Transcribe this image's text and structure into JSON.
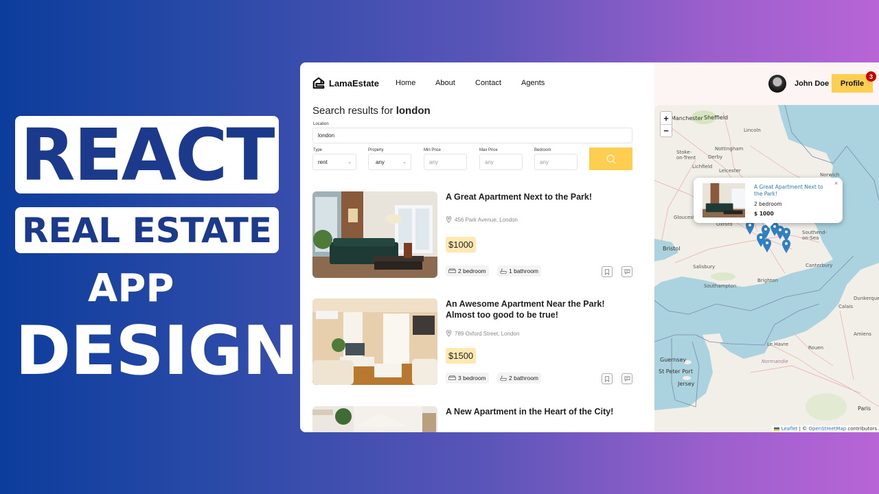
{
  "promo": {
    "line1": "REACT",
    "line2": "REAL ESTATE",
    "line3": "APP",
    "line4": "DESIGN"
  },
  "navbar": {
    "brand": "LamaEstate",
    "links": [
      "Home",
      "About",
      "Contact",
      "Agents"
    ],
    "user_name": "John Doe",
    "profile_label": "Profile",
    "notification_count": "3"
  },
  "search": {
    "title_prefix": "Search results for",
    "query": "london",
    "location_label": "Location",
    "location_value": "london",
    "type_label": "Type",
    "type_value": "rent",
    "property_label": "Property",
    "property_value": "any",
    "min_price_label": "Min Price",
    "min_price_placeholder": "any",
    "max_price_label": "Max Price",
    "max_price_placeholder": "any",
    "bedroom_label": "Bedroom",
    "bedroom_placeholder": "any"
  },
  "listings": [
    {
      "title": "A Great Apartment Next to the Park!",
      "address": "456 Park Avenue, London",
      "price": "$1000",
      "bedrooms": "2 bedroom",
      "bathrooms": "1 bathroom"
    },
    {
      "title": "An Awesome Apartment Near the Park! Almost too good to be true!",
      "address": "789 Oxford Street, London",
      "price": "$1500",
      "bedrooms": "3 bedroom",
      "bathrooms": "2 bathroom"
    },
    {
      "title": "A New Apartment in the Heart of the City!"
    }
  ],
  "map": {
    "zoom_in": "+",
    "zoom_out": "−",
    "popup": {
      "title": "A Great Apartment Next to the Park!",
      "bedrooms": "2 bedroom",
      "price": "$ 1000",
      "close": "×"
    },
    "attribution_leaflet": "Leaflet",
    "attribution_sep": " | © ",
    "attribution_osm": "OpenStreetMap",
    "attribution_suffix": " contributors",
    "labels": [
      "Manchester",
      "Sheffield",
      "Lincoln",
      "Nottingham",
      "Derby",
      "Stoke-on-Trent",
      "Lichfield",
      "Leicester",
      "Norwich",
      "Oxford",
      "Gloucester",
      "Bristol",
      "Salisbury",
      "Southampton",
      "Brighton",
      "Canterbury",
      "Southend-on-Sea",
      "Guernsey",
      "St Peter Port",
      "Jersey",
      "Le Havre",
      "Rouen",
      "Amiens",
      "Paris",
      "Normandie",
      "Calais",
      "Dunkerque"
    ]
  },
  "colors": {
    "accent": "#fece51",
    "badge": "#c90000",
    "link": "#2a7bb8",
    "marker": "#2f7fc4"
  }
}
